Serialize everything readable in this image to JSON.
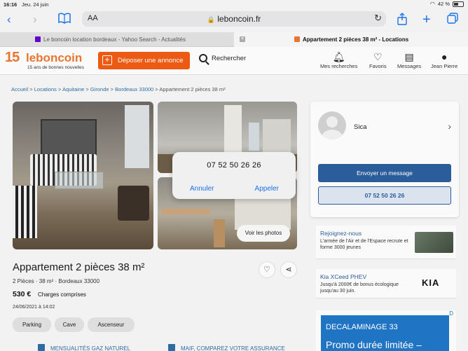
{
  "status_bar": {
    "time": "16:16",
    "date": "Jeu. 24 juin",
    "battery": "42 %"
  },
  "browser": {
    "aa_label": "AA",
    "url": "leboncoin.fr",
    "tabs": [
      {
        "label": "Le boncoin location bordeaux - Yahoo Search - Actualités",
        "favicon_color": "#5f01d1"
      },
      {
        "label": "Appartement 2 pièces 38 m² - Locations",
        "favicon_color": "#e9762e"
      }
    ]
  },
  "header": {
    "logo_num": "15",
    "logo_brand": "leboncoin",
    "logo_tagline": "15 ans de bonnes nouvelles",
    "deposit_label": "Déposer une annonce",
    "search_label": "Rechercher",
    "nav": [
      {
        "label": "Mes recherches",
        "icon": "bell-icon"
      },
      {
        "label": "Favoris",
        "icon": "heart-icon"
      },
      {
        "label": "Messages",
        "icon": "message-icon"
      },
      {
        "label": "Jean Pierre",
        "icon": "user-icon"
      }
    ]
  },
  "breadcrumb": {
    "items": [
      "Accueil",
      "Locations",
      "Aquitaine",
      "Gironde",
      "Bordeaux 33000"
    ],
    "current": "Appartement 2 pièces 38 m²",
    "separator": ">"
  },
  "gallery": {
    "voir_label": "Voir les photos"
  },
  "call_popup": {
    "number": "07 52 50 26 26",
    "cancel": "Annuler",
    "call": "Appeler"
  },
  "listing": {
    "title": "Appartement 2 pièces 38 m²",
    "subline": "2 Pièces · 38 m² · Bordeaux 33000",
    "price": "530 €",
    "charges": "Charges comprises",
    "date": "24/06/2021 à 14:02",
    "chips": [
      "Parking",
      "Cave",
      "Ascenseur"
    ],
    "bottom_links": [
      "MENSUALITÉS GAZ NATUREL",
      "MAIF, COMPAREZ VOTRE ASSURANCE"
    ]
  },
  "seller": {
    "name": "Sica",
    "message_btn": "Envoyer un message",
    "phone_btn": "07 52 50 26 26"
  },
  "ads": [
    {
      "title": "Rejoignez-nous",
      "body": "L'armée de l'Air et de l'Espace recrute et forme 3000 jeunes"
    },
    {
      "title": "Kia XCeed PHEV",
      "body": "Jusqu'à 2000€ de bonus écologique jusqu'au 30 juin.",
      "logo": "KIA"
    },
    {
      "line1": "DECALAMINAGE 33",
      "line2": "Promo durée limitée –",
      "tag": "D"
    }
  ],
  "colors": {
    "brand": "#e9762e",
    "deposit": "#ec5a13",
    "link": "#2d6ca3",
    "primary_btn": "#2c5d9b",
    "ios_blue": "#1a73e8"
  }
}
